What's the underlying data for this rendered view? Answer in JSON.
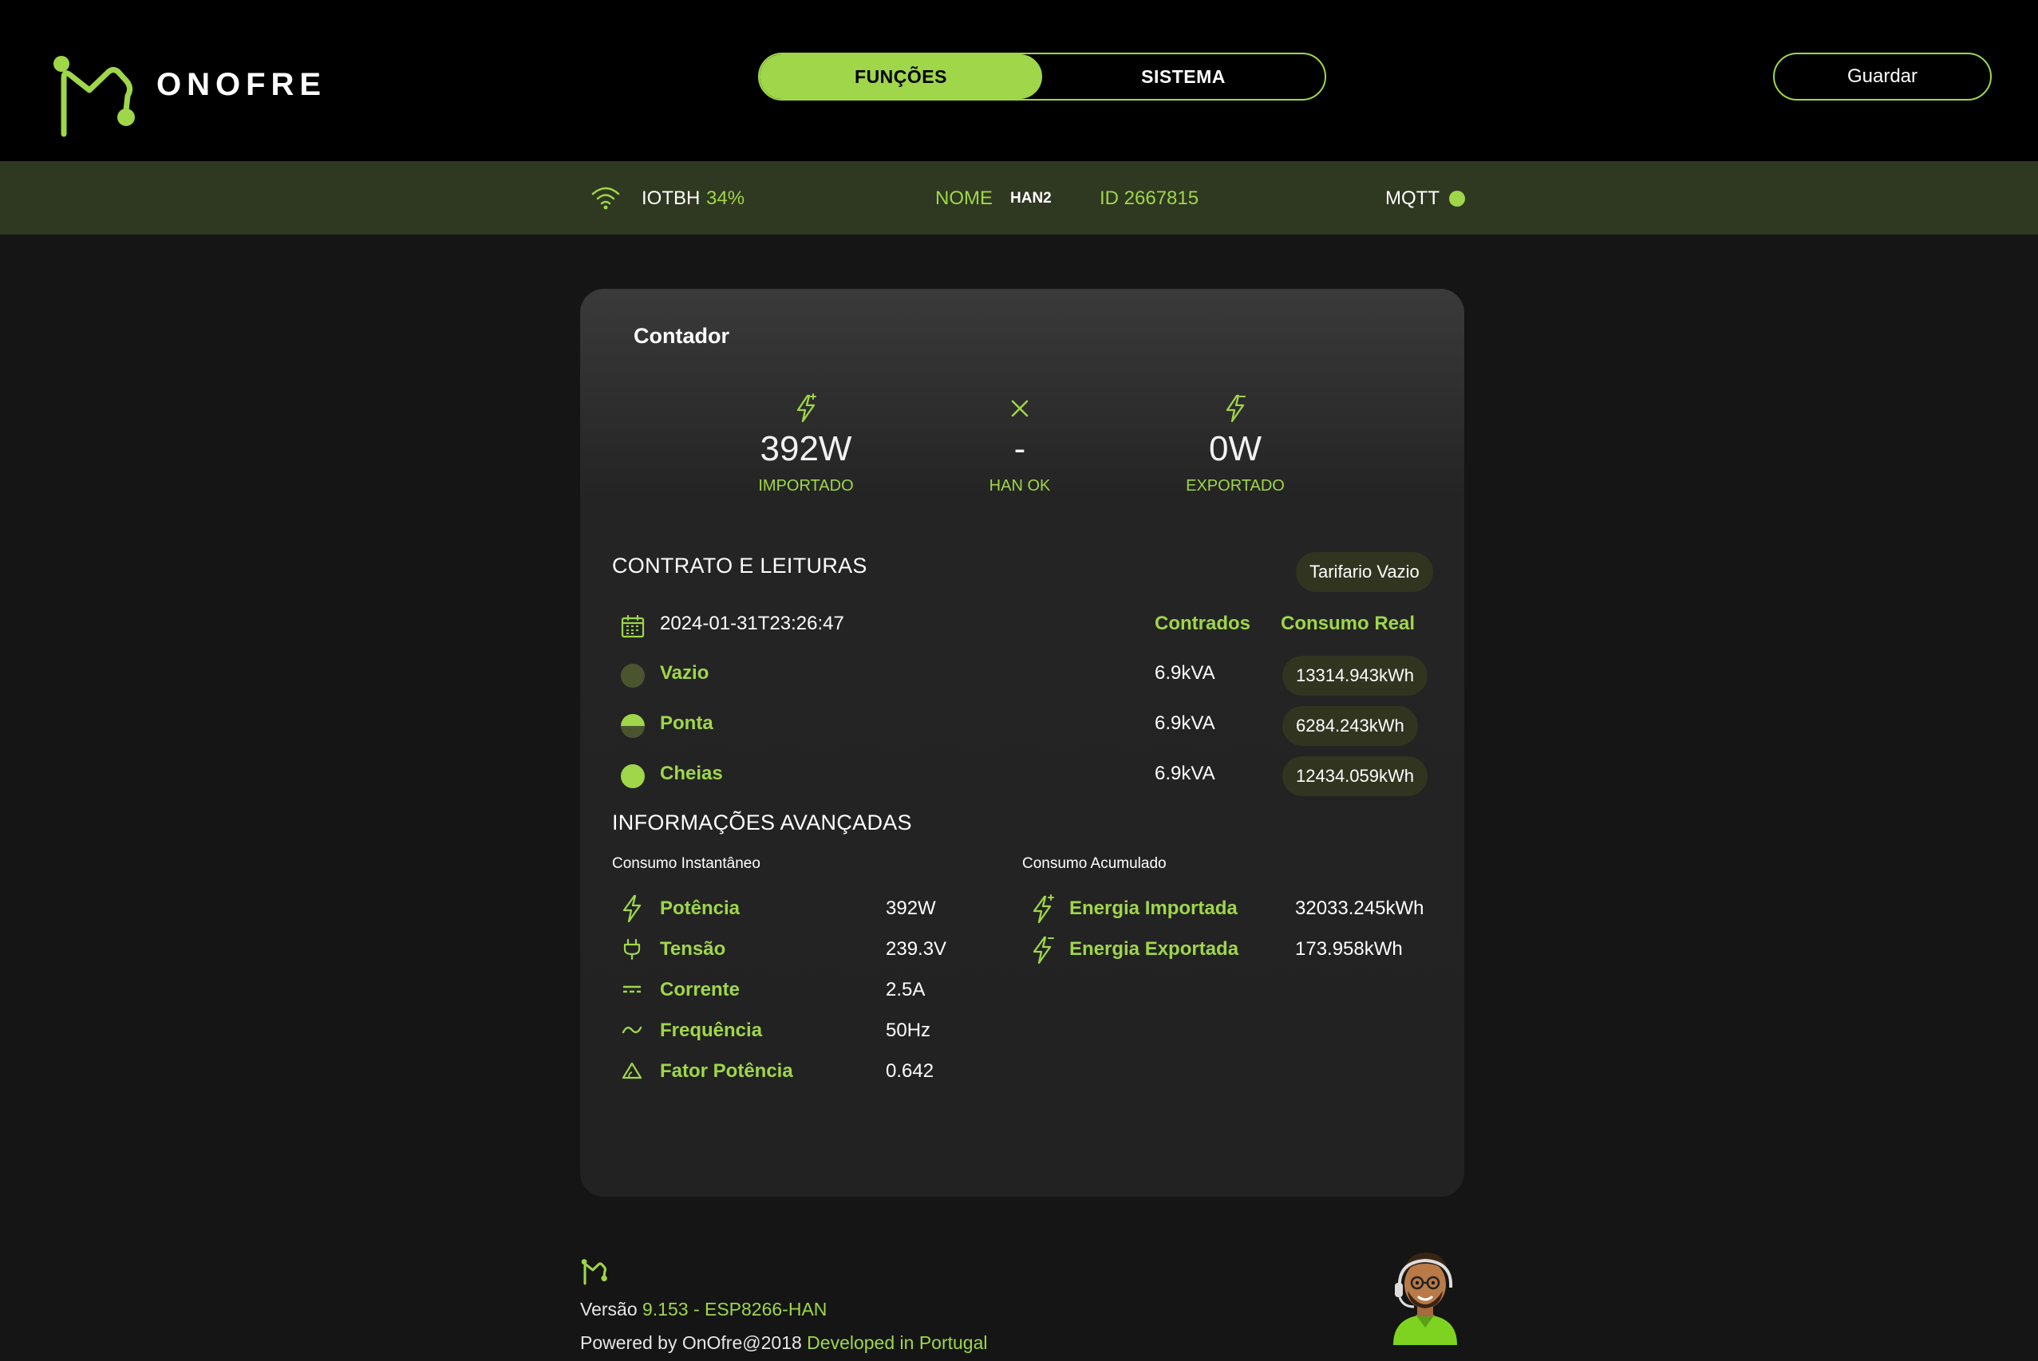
{
  "header": {
    "brand": "ONOFRE",
    "tabs": [
      {
        "label": "FUNÇÕES",
        "active": true
      },
      {
        "label": "SISTEMA",
        "active": false
      }
    ],
    "save_label": "Guardar"
  },
  "status": {
    "wifi_ssid": "IOTBH",
    "wifi_signal": "34%",
    "name_label": "NOME",
    "name_value": "HAN2",
    "id_text": "ID 2667815",
    "mqtt_label": "MQTT",
    "mqtt_status_color": "#9fd64a"
  },
  "card": {
    "title": "Contador",
    "metrics": [
      {
        "icon": "lightning-icon",
        "value": "392W",
        "label": "IMPORTADO"
      },
      {
        "icon": "x-icon",
        "value": "-",
        "label": "HAN OK"
      },
      {
        "icon": "lightning-icon",
        "value": "0W",
        "label": "EXPORTADO"
      }
    ],
    "contract": {
      "heading": "CONTRATO E LEITURAS",
      "tariff_badge": "Tarifario Vazio",
      "timestamp": "2024-01-31T23:26:47",
      "col_contracted": "Contrados",
      "col_real": "Consumo Real",
      "rows": [
        {
          "label": "Vazio",
          "contracted": "6.9kVA",
          "real": "13314.943kWh",
          "dot_color": "#4a5530"
        },
        {
          "label": "Ponta",
          "contracted": "6.9kVA",
          "real": "6284.243kWh",
          "dot_color": "#9fd64a"
        },
        {
          "label": "Cheias",
          "contracted": "6.9kVA",
          "real": "12434.059kWh",
          "dot_color": "#9fd64a"
        }
      ]
    },
    "advanced": {
      "heading": "INFORMAÇÕES AVANÇADAS",
      "instant_title": "Consumo Instantâneo",
      "accum_title": "Consumo Acumulado",
      "instant": [
        {
          "icon": "lightning-icon",
          "label": "Potência",
          "value": "392W"
        },
        {
          "icon": "plug-icon",
          "label": "Tensão",
          "value": "239.3V"
        },
        {
          "icon": "dc-current-icon",
          "label": "Corrente",
          "value": "2.5A"
        },
        {
          "icon": "wave-icon",
          "label": "Frequência",
          "value": "50Hz"
        },
        {
          "icon": "triangle-icon",
          "label": "Fator Potência",
          "value": "0.642"
        }
      ],
      "accumulated": [
        {
          "icon": "lightning-icon",
          "label": "Energia Importada",
          "value": "32033.245kWh"
        },
        {
          "icon": "lightning-icon",
          "label": "Energia Exportada",
          "value": "173.958kWh"
        }
      ]
    }
  },
  "footer": {
    "version_prefix": "Versão",
    "version": "9.153 - ESP8266-HAN",
    "powered": "Powered by OnOfre@2018",
    "developed": "Developed in Portugal"
  },
  "colors": {
    "accent": "#9fd64a",
    "background": "#151515",
    "status_bar": "#2f3820"
  }
}
